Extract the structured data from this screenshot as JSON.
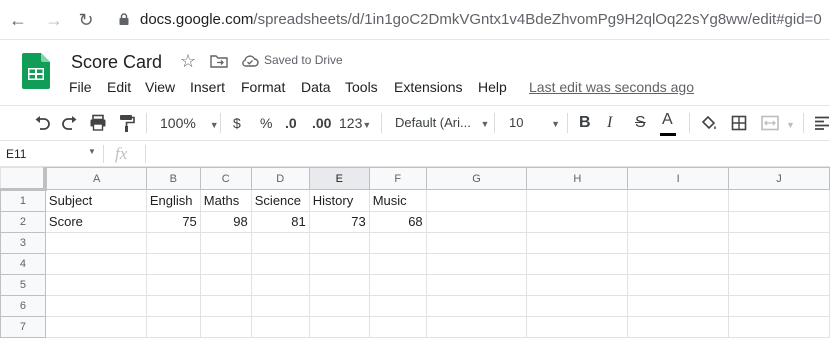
{
  "browser": {
    "url_host": "docs.google.com",
    "url_path": "/spreadsheets/d/1in1goC2DmkVGntx1v4BdeZhvomPg9H2qlOq22sYg8ww/edit#gid=0"
  },
  "doc": {
    "title": "Score Card",
    "saved_status": "Saved to Drive",
    "last_edit": "Last edit was seconds ago"
  },
  "menu": [
    "File",
    "Edit",
    "View",
    "Insert",
    "Format",
    "Data",
    "Tools",
    "Extensions",
    "Help"
  ],
  "toolbar": {
    "zoom": "100%",
    "currency": "$",
    "percent": "%",
    "dec_decrease": ".0",
    "dec_increase": ".00",
    "more_formats": "123",
    "font": "Default (Ari...",
    "font_size": "10"
  },
  "formula_bar": {
    "name_box": "E11",
    "fx": "fx"
  },
  "sheet": {
    "columns": [
      "A",
      "B",
      "C",
      "D",
      "E",
      "F",
      "G",
      "H",
      "I",
      "J"
    ],
    "selected_column": "E",
    "rows": [
      {
        "num": "1",
        "cells": [
          "Subject",
          "English",
          "Maths",
          "Science",
          "History",
          "Music",
          "",
          "",
          "",
          ""
        ]
      },
      {
        "num": "2",
        "cells": [
          "Score",
          "75",
          "98",
          "81",
          "73",
          "68",
          "",
          "",
          "",
          ""
        ]
      },
      {
        "num": "3",
        "cells": [
          "",
          "",
          "",
          "",
          "",
          "",
          "",
          "",
          "",
          ""
        ]
      },
      {
        "num": "4",
        "cells": [
          "",
          "",
          "",
          "",
          "",
          "",
          "",
          "",
          "",
          ""
        ]
      },
      {
        "num": "5",
        "cells": [
          "",
          "",
          "",
          "",
          "",
          "",
          "",
          "",
          "",
          ""
        ]
      },
      {
        "num": "6",
        "cells": [
          "",
          "",
          "",
          "",
          "",
          "",
          "",
          "",
          "",
          ""
        ]
      },
      {
        "num": "7",
        "cells": [
          "",
          "",
          "",
          "",
          "",
          "",
          "",
          "",
          "",
          ""
        ]
      }
    ]
  },
  "colors": {
    "sheets_green": "#0f9d58",
    "header_bg": "#f8f9fa",
    "selected_header_bg": "#e8eaed"
  }
}
